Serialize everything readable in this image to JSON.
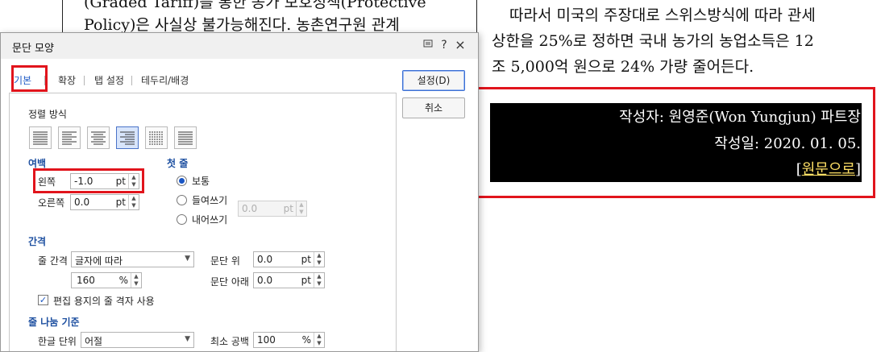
{
  "document": {
    "left_lines": [
      "(Graded Tariff)를 통한 농가 보호정책(Protective",
      "Policy)은 사실상 불가능해진다. 농촌연구원 관계"
    ],
    "right_lines": [
      "따라서 미국의 주장대로 스위스방식에 따라 관세",
      "상한을 25%로 정하면 국내 농가의 농업소득은 12",
      "조 5,000억 원으로 24% 가량 줄어든다."
    ],
    "author": "작성자: 원영준(Won Yungjun) 파트장",
    "date": "작성일: 2020. 01. 05.",
    "link_open": "[",
    "link_text": "원문으로",
    "link_close": "]"
  },
  "dialog": {
    "title": "문단 모양",
    "title_icons": [
      "restore-icon",
      "help-icon",
      "close-icon"
    ],
    "help_glyph": "?",
    "close_glyph": "×",
    "tabs": [
      "기본",
      "확장",
      "탭 설정",
      "테두리/배경"
    ],
    "buttons": {
      "ok": "설정(D)",
      "cancel": "취소"
    },
    "alignment": {
      "label": "정렬 방식",
      "options": [
        "justify",
        "left",
        "center",
        "right",
        "distribute",
        "divide"
      ],
      "selected": "right"
    },
    "margin": {
      "section": "여백",
      "left_label": "왼쪽",
      "left_value": "-1.0",
      "right_label": "오른쪽",
      "right_value": "0.0",
      "unit": "pt"
    },
    "first_line": {
      "section": "첫 줄",
      "options": [
        "보통",
        "들여쓰기",
        "내어쓰기"
      ],
      "selected": "보통",
      "value": "0.0",
      "unit": "pt"
    },
    "spacing": {
      "section": "간격",
      "line_label": "줄 간격",
      "line_type": "글자에 따라",
      "line_value": "160",
      "line_unit": "%",
      "above_label": "문단 위",
      "above_value": "0.0",
      "below_label": "문단 아래",
      "below_value": "0.0",
      "unit": "pt",
      "grid_label": "편집 용지의 줄 격자 사용",
      "grid_checked": true
    },
    "line_break": {
      "section": "줄 나눔 기준",
      "hangul_label": "한글 단위",
      "hangul_value": "어절",
      "min_space_label": "최소 공백",
      "min_space_value": "100",
      "min_space_unit": "%"
    }
  },
  "colors": {
    "highlight": "#e1141c",
    "accent": "#1a56c4",
    "selection": "#000000",
    "link": "#ffe066"
  }
}
